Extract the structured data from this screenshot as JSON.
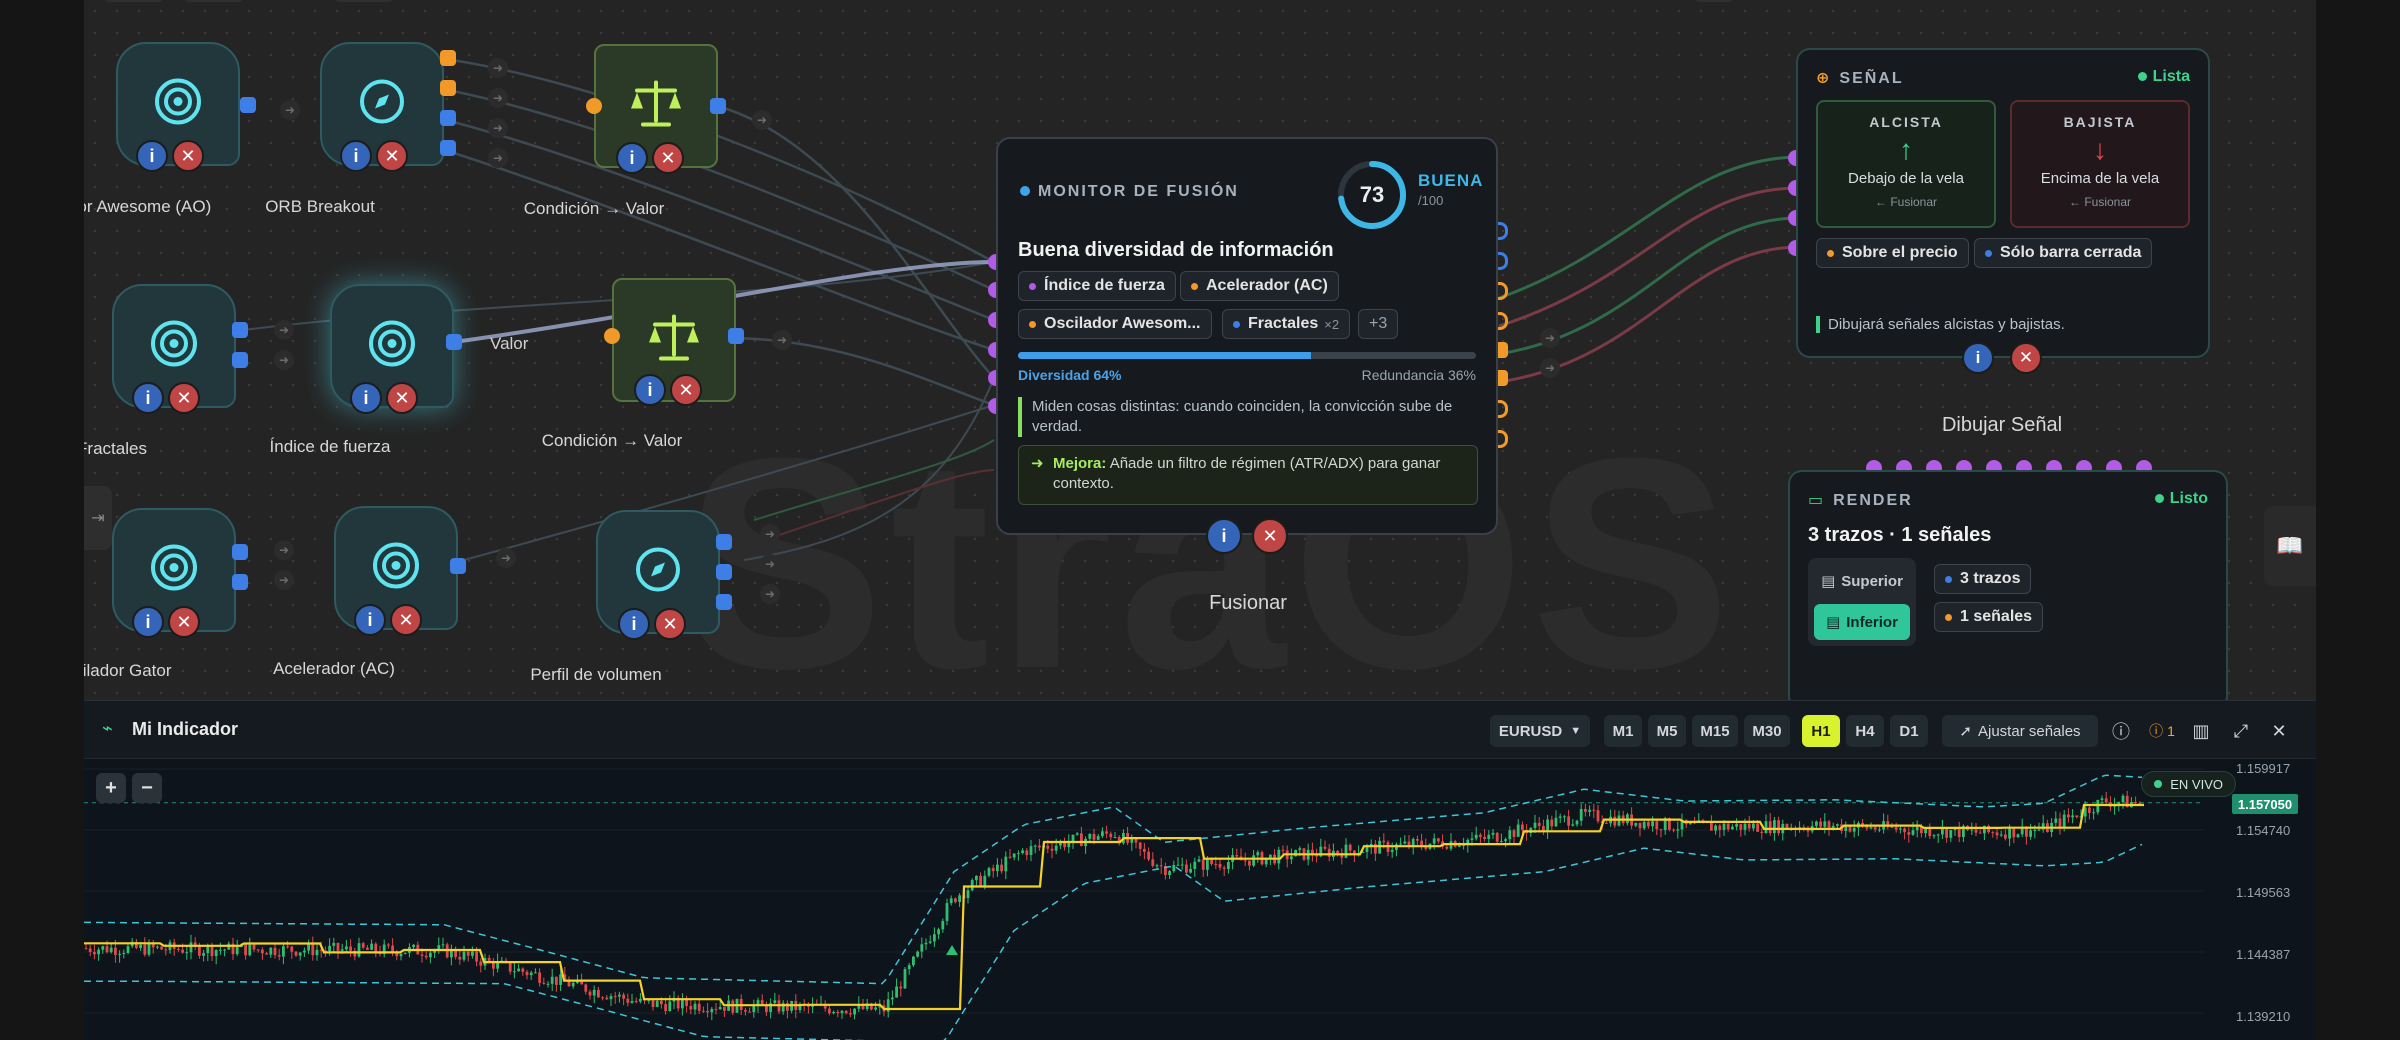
{
  "canvas": {
    "watermark": "StraOS",
    "nodes": [
      {
        "id": "ao",
        "label": "Oscilador Awesome (AO)",
        "icon": "target-icon"
      },
      {
        "id": "orb",
        "label": "ORB Breakout",
        "icon": "compass-icon"
      },
      {
        "id": "cond1",
        "label": "Condición → Valor",
        "icon": "scale-icon"
      },
      {
        "id": "fractales",
        "label": "Fractales",
        "icon": "target-icon"
      },
      {
        "id": "fuerza",
        "label": "Índice de fuerza",
        "icon": "target-icon"
      },
      {
        "id": "cond2",
        "label": "Condición → Valor",
        "icon": "scale-icon"
      },
      {
        "id": "gator",
        "label": "Oscilador Gator",
        "icon": "target-icon"
      },
      {
        "id": "ac",
        "label": "Acelerador (AC)",
        "icon": "target-icon"
      },
      {
        "id": "perfil",
        "label": "Perfil de volumen",
        "icon": "compass-icon"
      }
    ],
    "edge_label": "Valor",
    "info_symbol": "i",
    "delete_symbol": "✕"
  },
  "fusion": {
    "header": "MONITOR DE FUSIÓN",
    "score": "73",
    "score_value": 73,
    "grade": "BUENA",
    "grade_sub": "/100",
    "title": "Buena diversidad de información",
    "chips": [
      {
        "label": "Índice de fuerza",
        "color": "#b15be6"
      },
      {
        "label": "Acelerador (AC)",
        "color": "#f19a2a"
      },
      {
        "label": "Oscilador Awesom...",
        "color": "#f19a2a"
      },
      {
        "label": "Fractales",
        "color": "#3d7fe6",
        "count": "×2"
      },
      {
        "label": "+3"
      }
    ],
    "diversity_label": "Diversidad 64%",
    "diversity_value": 64,
    "redundancy_label": "Redundancia 36%",
    "note": "Miden cosas distintas: cuando coinciden, la convicción sube de verdad.",
    "tip_bold": "Mejora:",
    "tip_text": "Añade un filtro de régimen (ATR/ADX) para ganar contexto.",
    "node_label": "Fusionar"
  },
  "senal": {
    "header": "SEÑAL",
    "status": "Lista",
    "up": {
      "title": "ALCISTA",
      "text": "Debajo de la vela",
      "from": "← Fusionar"
    },
    "down": {
      "title": "BAJISTA",
      "text": "Encima de la vela",
      "from": "← Fusionar"
    },
    "chips": [
      "Sobre el precio",
      "Sólo barra cerrada"
    ],
    "note": "Dibujará señales alcistas y bajistas.",
    "node_label": "Dibujar Señal"
  },
  "render": {
    "header": "RENDER",
    "status": "Listo",
    "summary": "3 trazos · 1 señales",
    "opt_top": "Superior",
    "opt_bottom": "Inferior",
    "chips": [
      "3 trazos",
      "1 señales"
    ]
  },
  "chart_panel": {
    "title": "Mi Indicador",
    "symbol": "EURUSD",
    "timeframes": [
      "M1",
      "M5",
      "M15",
      "M30",
      "H1",
      "H4",
      "D1"
    ],
    "active_tf": "H1",
    "adjust": "Ajustar señales",
    "warn_count": "1",
    "live": "EN VIVO",
    "current_price": "1.157050",
    "y_ticks": [
      "1.159917",
      "1.154740",
      "1.149563",
      "1.144387",
      "1.139210"
    ],
    "zoom_in": "+",
    "zoom_out": "−"
  },
  "colors": {
    "accent": "#3fb7e6",
    "green": "#3ed38a",
    "lime": "#d8f22e",
    "bull_candle": "#2fbf71",
    "bear_candle": "#e04a4a",
    "upper_line": "#f2d22a",
    "band": "#3fc6d6"
  }
}
